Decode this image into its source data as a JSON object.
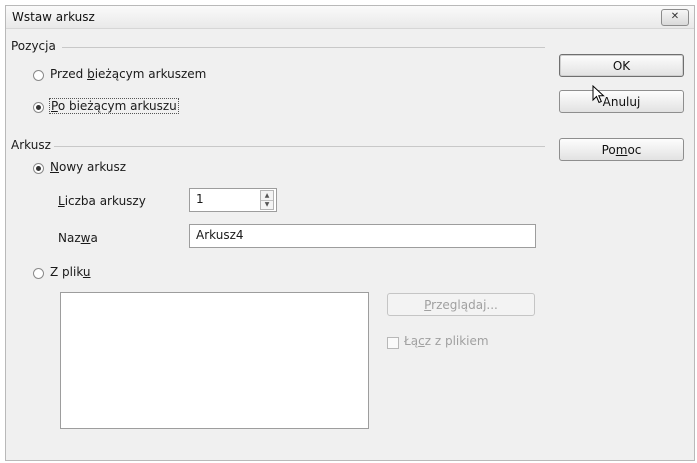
{
  "window": {
    "title": "Wstaw arkusz",
    "close_icon": "close-icon"
  },
  "position_section": {
    "label": "Pozycja",
    "options": [
      {
        "label": "Przed bieżącym arkuszem",
        "checked": false
      },
      {
        "label": "Po bieżącym arkuszu",
        "checked": true
      }
    ]
  },
  "sheet_section": {
    "label": "Arkusz",
    "new_sheet": {
      "label": "Nowy arkusz",
      "checked": true
    },
    "count": {
      "label": "Liczba arkuszy",
      "value": "1"
    },
    "name": {
      "label": "Nazwa",
      "value": "Arkusz4"
    },
    "from_file": {
      "label": "Z pliku",
      "checked": false
    },
    "browse_label": "Przeglądaj...",
    "link_label": "Łącz z plikiem"
  },
  "buttons": {
    "ok": "OK",
    "cancel": "Anuluj",
    "help": "Pomoc"
  }
}
